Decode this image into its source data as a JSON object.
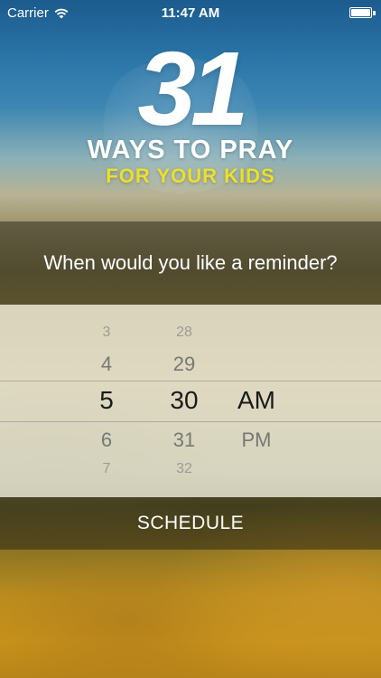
{
  "status_bar": {
    "carrier": "Carrier",
    "time": "11:47 AM",
    "wifi_icon": "wifi-icon",
    "battery_icon": "battery-icon",
    "battery_level": 1.0
  },
  "logo": {
    "number": "31",
    "line1": "WAYS TO PRAY",
    "line2": "FOR YOUR KIDS",
    "line2_color": "#ece02a"
  },
  "prompt": {
    "text": "When would you like a reminder?"
  },
  "picker": {
    "hours": [
      "3",
      "4",
      "5",
      "6",
      "7"
    ],
    "minutes": [
      "28",
      "29",
      "30",
      "31",
      "32"
    ],
    "period": [
      "AM",
      "PM"
    ],
    "selected": {
      "hour": "5",
      "minute": "30",
      "period": "AM"
    }
  },
  "schedule": {
    "label": "SCHEDULE"
  },
  "colors": {
    "sky_top": "#1c5b8e",
    "gold_bottom": "#c8921a",
    "picker_bg": "#eceae0",
    "logo_accent": "#ece02a"
  }
}
